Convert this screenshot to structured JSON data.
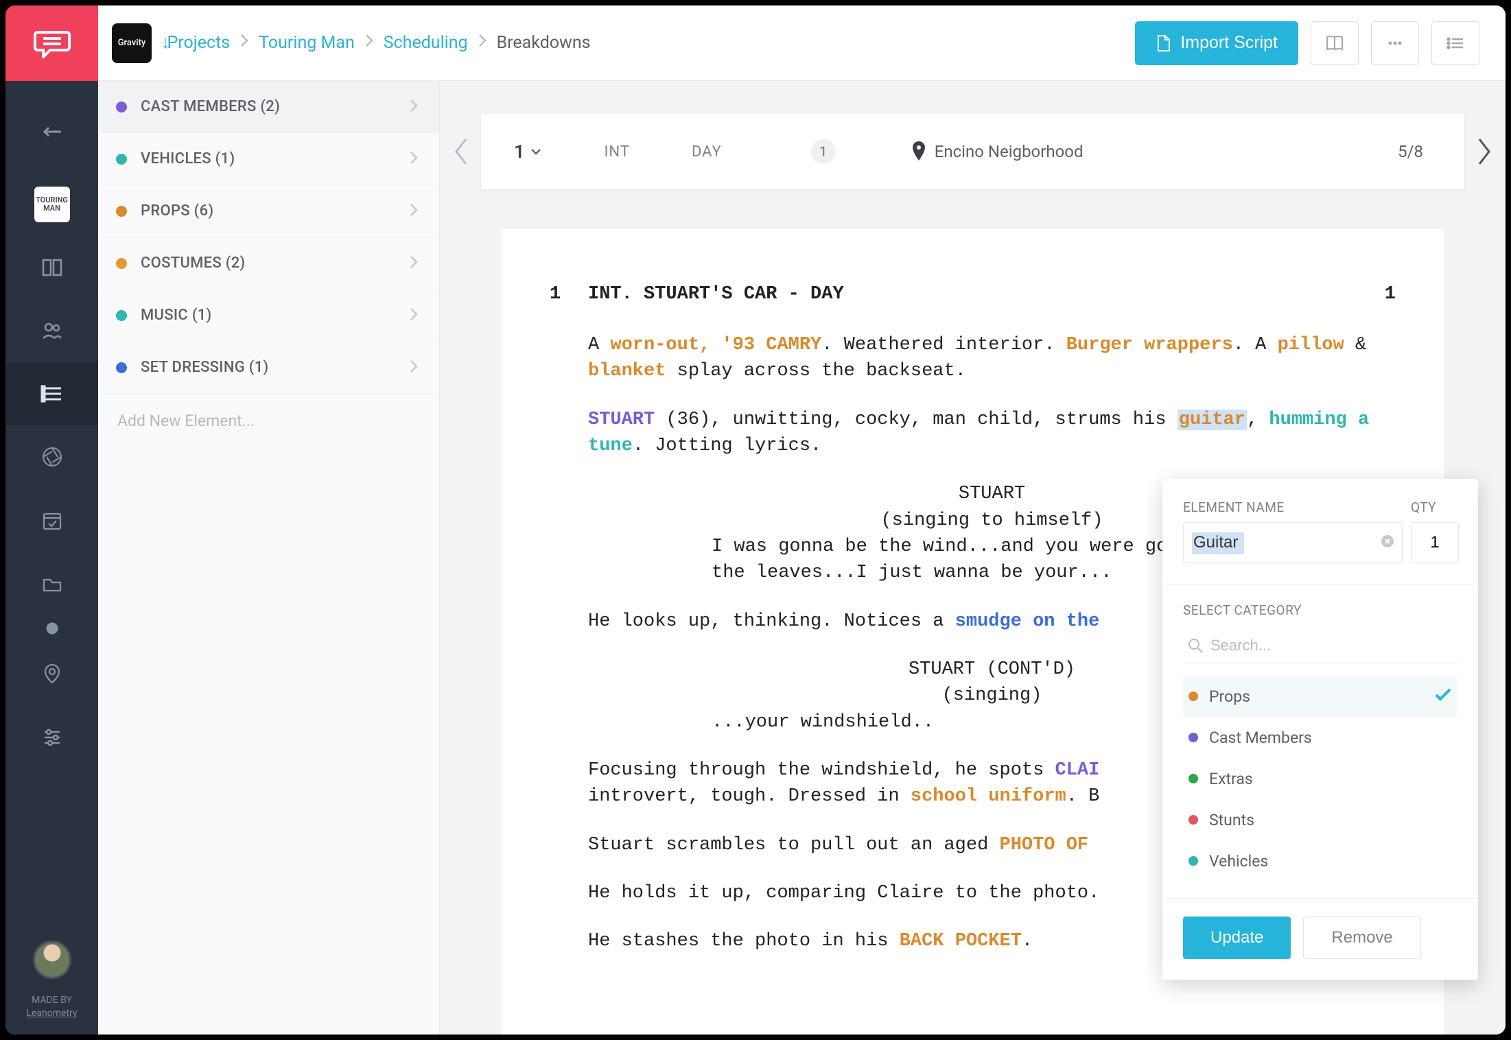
{
  "breadcrumbs": {
    "projects": "Projects",
    "project_name": "Touring Man",
    "section": "Scheduling",
    "current": "Breakdowns"
  },
  "project_badge": "Gravity",
  "topbar": {
    "import_script": "Import Script"
  },
  "sidebar": {
    "categories": [
      {
        "label": "CAST MEMBERS (2)",
        "color": "#7a5cd6"
      },
      {
        "label": "VEHICLES (1)",
        "color": "#2fb6b0"
      },
      {
        "label": "PROPS (6)",
        "color": "#d98a2b"
      },
      {
        "label": "COSTUMES (2)",
        "color": "#e39a2f"
      },
      {
        "label": "MUSIC (1)",
        "color": "#2fb6b0"
      },
      {
        "label": "SET DRESSING (1)",
        "color": "#3a6dd8"
      }
    ],
    "add_placeholder": "Add New Element..."
  },
  "scene_nav": {
    "scene_number": "1",
    "int_ext": "INT",
    "day_night": "DAY",
    "badge": "1",
    "location": "Encino Neigborhood",
    "pages": "5/8"
  },
  "script": {
    "scene_num_left": "1",
    "scene_num_right": "1",
    "slugline": "INT. STUART'S CAR - DAY",
    "p1_a": "A ",
    "p1_vehicle": "worn-out, '93 CAMRY",
    "p1_b": ". Weathered interior. ",
    "p1_prop1": "Burger wrappers",
    "p1_c": ". A ",
    "p1_prop2": "pillow",
    "p1_d": " & ",
    "p1_prop3": "blanket",
    "p1_e": " splay across the backseat.",
    "p2_cast": "STUART",
    "p2_a": " (36), unwitting, cocky, man child, strums his ",
    "p2_guitar": "guitar",
    "p2_b": ", ",
    "p2_music": "humming a tune",
    "p2_c": ". Jotting lyrics.",
    "char1": "STUART",
    "paren1": "(singing to himself)",
    "dialog1": "I was gonna be the wind...and you were gonna be the leaves...I just wanna be your...",
    "p3_a": "He looks up, thinking. Notices a ",
    "p3_set": "smudge on the",
    "char2": "STUART (CONT'D)",
    "paren2": "(singing)",
    "dialog2": "...your windshield..",
    "p4_a": "Focusing through the windshield, he spots ",
    "p4_cast": "CLAI",
    "p4_b": " introvert, tough. Dressed in ",
    "p4_cost": "school uniform",
    "p4_c": ". B",
    "p5_a": "Stuart scrambles to pull out an aged ",
    "p5_prop": "PHOTO OF ",
    "p6": "He holds it up, comparing Claire to the photo.",
    "p7_a": "He stashes the photo in his ",
    "p7_prop": "BACK POCKET",
    "p7_b": "."
  },
  "popover": {
    "element_name_label": "ELEMENT NAME",
    "qty_label": "QTY",
    "element_name_value": "Guitar",
    "qty_value": "1",
    "select_category_label": "SELECT CATEGORY",
    "search_placeholder": "Search...",
    "categories": [
      {
        "label": "Props",
        "color": "#d98a2b",
        "selected": true
      },
      {
        "label": "Cast Members",
        "color": "#7a5cd6",
        "selected": false
      },
      {
        "label": "Extras",
        "color": "#2ea54a",
        "selected": false
      },
      {
        "label": "Stunts",
        "color": "#e25563",
        "selected": false
      },
      {
        "label": "Vehicles",
        "color": "#2fb6b0",
        "selected": false
      }
    ],
    "update_label": "Update",
    "remove_label": "Remove"
  },
  "footer": {
    "made_by": "MADE BY",
    "brand": "Leanometry"
  },
  "rail_mini": "TOURING\nMAN"
}
